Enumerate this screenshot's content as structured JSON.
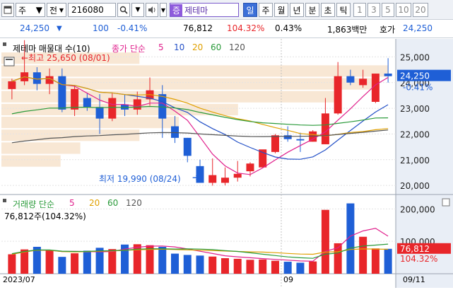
{
  "toolbar": {
    "market_select": "주",
    "jeon_label": "전",
    "code_value": "216080",
    "theme_button": "제테마",
    "theme_badge": "증",
    "periods": [
      "일",
      "주",
      "월",
      "년",
      "분",
      "초",
      "틱"
    ],
    "active_period": "일",
    "intervals": [
      "1",
      "3",
      "5",
      "10",
      "20"
    ]
  },
  "ticker": {
    "price": "24,250",
    "change": "100",
    "change_pct": "-0.41%",
    "volume": "76,812",
    "volume_ratio": "104.32%",
    "turnover": "0.43%",
    "amount": "1,863백만",
    "hoga_label": "호가",
    "hoga_price": "24,250"
  },
  "price_chart": {
    "title": "제테마 매물대 수(10)",
    "ma_label": "종가 단순",
    "ma_periods": [
      "5",
      "10",
      "20",
      "60",
      "120"
    ],
    "high_label": "←최고 25,650 (08/01)",
    "low_label": "최저 19,990 (08/24)",
    "y_ticks": [
      "25,000",
      "24,000",
      "23,000",
      "22,000",
      "21,000",
      "20,000"
    ],
    "current_price": "24,250",
    "current_pct": "-0.41%"
  },
  "volume_chart": {
    "label": "거래량 단순",
    "ma_periods": [
      "5",
      "20",
      "60",
      "120"
    ],
    "current_label": "76,812주(104.32%)",
    "y_ticks": [
      "200,000",
      "100,000"
    ],
    "current_value": "76,812",
    "current_pct": "104.32%"
  },
  "x_axis": {
    "left": "2023/07",
    "mid": "09",
    "right": "09/11"
  },
  "colors": {
    "up": "#e8262a",
    "down": "#1f5fd6",
    "ma5": "#e0208c",
    "ma10": "#2451c7",
    "ma20": "#e0a000",
    "ma60": "#2a9a3a",
    "ma120": "#555555"
  },
  "chart_data": {
    "type": "candlestick",
    "candles": [
      [
        23750,
        24150,
        23350,
        24050
      ],
      [
        24050,
        25650,
        23900,
        24400
      ],
      [
        24400,
        24600,
        23700,
        23950
      ],
      [
        23950,
        24550,
        23550,
        24250
      ],
      [
        24250,
        24550,
        22850,
        22950
      ],
      [
        22950,
        23900,
        22700,
        23750
      ],
      [
        23400,
        23600,
        22900,
        23050
      ],
      [
        23050,
        23550,
        22000,
        22600
      ],
      [
        22600,
        23600,
        22500,
        23400
      ],
      [
        23150,
        23550,
        22700,
        22950
      ],
      [
        22950,
        23650,
        22750,
        23350
      ],
      [
        23350,
        24200,
        23100,
        23700
      ],
      [
        23550,
        23900,
        21850,
        22600
      ],
      [
        22300,
        22700,
        21650,
        21850
      ],
      [
        21850,
        21850,
        20900,
        21150
      ],
      [
        20750,
        21000,
        20150,
        20100
      ],
      [
        20100,
        21050,
        19990,
        20400
      ],
      [
        20100,
        20700,
        20000,
        20300
      ],
      [
        20300,
        20950,
        20150,
        20450
      ],
      [
        20550,
        20900,
        20350,
        20850
      ],
      [
        20700,
        21300,
        20800,
        21400
      ],
      [
        21300,
        22000,
        21250,
        21950
      ],
      [
        21950,
        22300,
        21700,
        21800
      ],
      [
        21800,
        22050,
        21300,
        21750
      ],
      [
        21700,
        22150,
        21700,
        22100
      ],
      [
        21600,
        23400,
        21600,
        22800
      ],
      [
        22800,
        24800,
        22750,
        24250
      ],
      [
        24250,
        24500,
        23900,
        24000
      ],
      [
        23900,
        24500,
        23800,
        24150
      ],
      [
        23250,
        24350,
        23200,
        24350
      ],
      [
        24350,
        24950,
        24000,
        24250
      ]
    ],
    "volume": [
      60000,
      75000,
      83000,
      72000,
      52000,
      63000,
      71000,
      80000,
      76000,
      90000,
      91000,
      88000,
      83000,
      62000,
      58000,
      56000,
      53000,
      48000,
      46000,
      43000,
      44000,
      40000,
      37000,
      34000,
      38000,
      197000,
      94000,
      217000,
      114000,
      78000,
      76812
    ],
    "ylim_price": [
      19700,
      25700
    ],
    "ylim_volume": [
      0,
      240000
    ]
  }
}
